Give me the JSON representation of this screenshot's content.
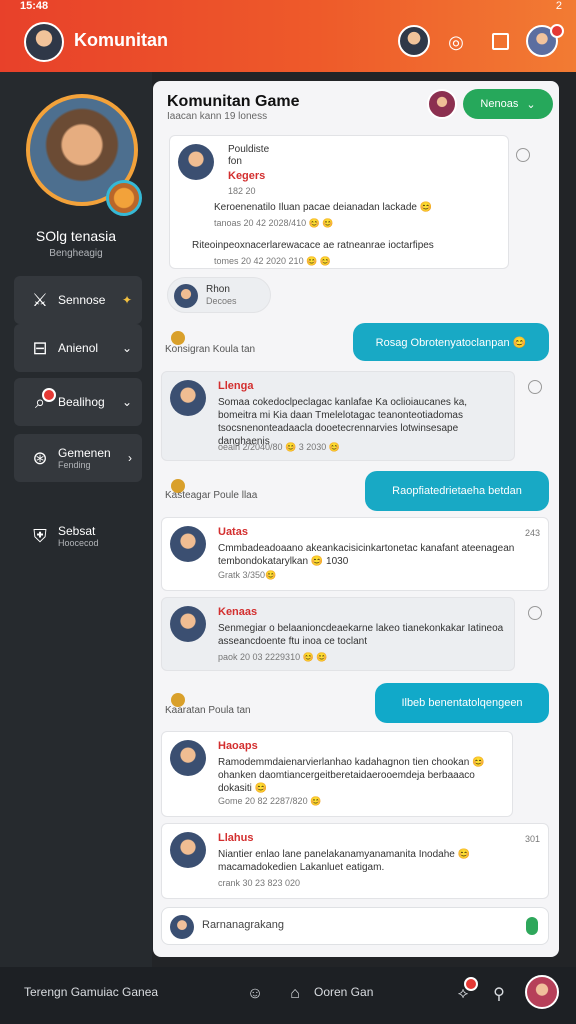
{
  "status_bar": {
    "time": "15:48",
    "battery": "2"
  },
  "app_bar": {
    "title": "Komunitan",
    "icons": [
      "user-icon",
      "headset-icon",
      "square-icon",
      "profile-icon"
    ]
  },
  "sidebar": {
    "profile_name": "SOlg tenasia",
    "profile_sub": "Bengheagig",
    "items": [
      {
        "label": "Sennose",
        "icon": "sword-icon"
      },
      {
        "label": "Anienol",
        "icon": "table-icon"
      },
      {
        "label": "Bealihog",
        "icon": "search-icon"
      },
      {
        "label": "Gemenen",
        "sub": "Fending",
        "icon": "globe-icon"
      },
      {
        "label": "Sebsat",
        "sub": "Hoocecod",
        "icon": "shield-icon"
      }
    ]
  },
  "panel": {
    "title": "Komunitan Game",
    "subtitle": "Iaacan kann  19 loness",
    "button_label": "Nenoas",
    "messages": [
      {
        "type": "card",
        "name": "Kegers",
        "lines": [
          "Pouldiste",
          "fon"
        ],
        "meta": "182 20",
        "text": "Keroenenatilo Iluan pacae deianadan lackade 😊",
        "time": "tanoas 20 42 2028/410 😊 😊"
      },
      {
        "type": "thread",
        "text": "Riteoinpeoxnacerlarewacace ae ratneanrae ioctarfipes",
        "time": "tomes 20 42 2020 210 😊 😊"
      },
      {
        "type": "pill",
        "name": "Rhon",
        "sub": "Decoes"
      },
      {
        "type": "divider",
        "text": "Konsigran Koula tan"
      },
      {
        "type": "bubble",
        "text": "Rosag Obrotenyatoclanpan 😊"
      },
      {
        "type": "grey",
        "name": "Llenga",
        "text": "Somaa cokedoclpeclagac kanlafae Ka oclioiaucanes ka, bomeitra mi Kia daan Tmelelotagac teanonteotiadomas tsocsnenonteadaacla dooetecrennarvies lotwinsesape danghaenis",
        "time": "oealn 2/2040/80 😊 3 2030 😊"
      },
      {
        "type": "divider",
        "text": "Kasteagar Poule llaa"
      },
      {
        "type": "bubble",
        "text": "Raopfiatedrietaeha betdan"
      },
      {
        "type": "card",
        "name": "Uatas",
        "text": "Cmmbadeadoaano akeankacisicinkartonetac kanafant ateenagean tembondokatarylkan 😊 1030",
        "meta": "Gratk 3/350😊",
        "time": "243"
      },
      {
        "type": "grey",
        "name": "Kenaas",
        "text": "Senmegiar o belaanioncdeaekarne lakeo tianekonkakar Iatineoa asseancdoente ftu inoa ce toclant",
        "time": "paok 20 03 2229310 😊 😊"
      },
      {
        "type": "divider",
        "text": "Kaaratan Poula tan"
      },
      {
        "type": "bubble",
        "text": "Ilbeb benentatolqengeen"
      },
      {
        "type": "card",
        "name": "Haoaps",
        "text": "Ramodemmdaienarvierlanhao kadahagnon tien chookan 😊 ohanken daomtiancergeitberetaidaerooemdeja berbaaaco dokasiti 😊",
        "meta": "Gome 20 82 2287/820 😊"
      },
      {
        "type": "card",
        "name": "Llahus",
        "text": "Niantier enlao lane panelakanamyanamanita Inodahe 😊 macamadokedien Lakanluet eatigam.",
        "meta": "crank 30 23 823 020",
        "time": "301"
      }
    ],
    "composer_placeholder": "Rarnanagrakang"
  },
  "bottom_bar": {
    "left_text": "Terengn Gamuiac Ganea",
    "mid_text": "Ooren Gan"
  }
}
